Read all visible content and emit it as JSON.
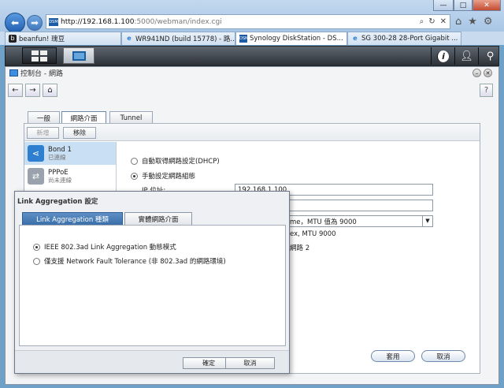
{
  "browser": {
    "url_host": "http://192.168.1.100",
    "url_path": ":5000/webman/index.cgi",
    "url_favicon": "DSM",
    "window_controls": {
      "minimize": "—",
      "maximize": "□",
      "close": "✕"
    },
    "tabs": [
      {
        "label": "beanfun! 瑰豆",
        "icon": "beanfun-icon",
        "active": false
      },
      {
        "label": "WR941ND (build 15778) - 路...",
        "icon": "ie-icon",
        "active": false
      },
      {
        "label": "Synology DiskStation - DS...",
        "icon": "dsm-icon",
        "active": true
      },
      {
        "label": "SG 300-28 28-Port Gigabit ...",
        "icon": "ie-icon",
        "active": false
      }
    ]
  },
  "app": {
    "breadcrumb": "控制台 - 網路",
    "tabs": [
      "一般",
      "網路介面",
      "Tunnel"
    ],
    "active_tab": 1,
    "toolbar": {
      "create": "新增",
      "remove": "移除"
    },
    "interfaces": [
      {
        "name": "Bond 1",
        "status": "已連線",
        "icon_color": "#2f7fd0"
      },
      {
        "name": "PPPoE",
        "status": "尚未連線",
        "icon_color": "#9aa3ad"
      }
    ],
    "dhcp_label": "自動取得網路設定(DHCP)",
    "manual_label": "手動設定網路組態",
    "ip_label": "IP 位址:",
    "ip_value": "192.168.1.100",
    "mtu_select_value": "me，MTU 值為 9000",
    "info_line1": "ex, MTU 9000",
    "info_line2": "網路 2",
    "apply": "套用",
    "cancel": "取消"
  },
  "dialog": {
    "title": "Link Aggregation 設定",
    "tabs": [
      "Link Aggregation 種類",
      "實體網路介面"
    ],
    "active_tab": 0,
    "options": [
      {
        "label": "IEEE 802.3ad Link Aggregation 動態模式",
        "selected": true
      },
      {
        "label": "僅支援 Network Fault Tolerance (非 802.3ad 的網路環境)",
        "selected": false
      }
    ],
    "ok": "確定",
    "cancel": "取消"
  }
}
